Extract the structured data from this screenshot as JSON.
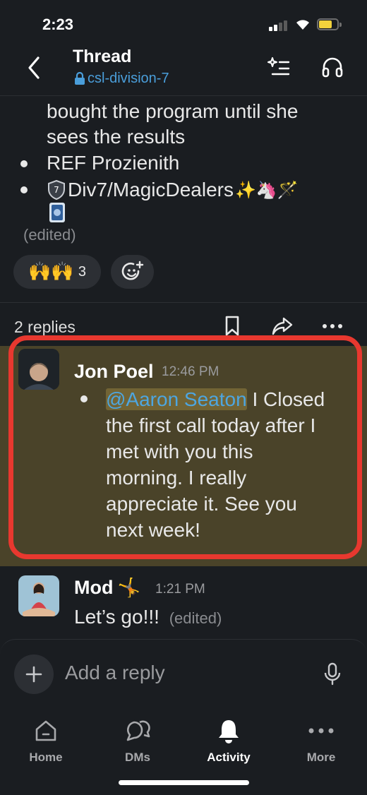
{
  "status": {
    "time": "2:23"
  },
  "header": {
    "title": "Thread",
    "channel": "csl-division-7"
  },
  "parent": {
    "continuation_lines": [
      "bought the program until she",
      "sees the results"
    ],
    "bullets": [
      "REF Prozienith",
      "Div7/MagicDealers"
    ],
    "bullet2_emojis": "✨🦄🪄",
    "edited_label": "(edited)",
    "reaction": {
      "emojis": "🙌🙌",
      "count": "3"
    }
  },
  "thread_bar": {
    "replies_label": "2 replies"
  },
  "replies": [
    {
      "author": "Jon Poel",
      "time": "12:46 PM",
      "mention": "@Aaron Seaton",
      "lines": [
        " I Closed",
        "the first call today after I",
        "met with you this",
        "morning. I really",
        "appreciate it. See you",
        "next week!"
      ]
    },
    {
      "author": "Mod",
      "author_emoji": "🤸",
      "time": "1:21 PM",
      "text": "Let’s go!!!",
      "edited_label": "(edited)"
    }
  ],
  "composer": {
    "placeholder": "Add a reply"
  },
  "tabs": [
    {
      "label": "Home",
      "icon": "home-icon"
    },
    {
      "label": "DMs",
      "icon": "dms-icon"
    },
    {
      "label": "Activity",
      "icon": "bell-icon",
      "active": true
    },
    {
      "label": "More",
      "icon": "more-icon"
    }
  ],
  "colors": {
    "accent_link": "#4a9eda",
    "highlight_bg": "#4a4329",
    "annotation_frame": "#e8382f"
  }
}
